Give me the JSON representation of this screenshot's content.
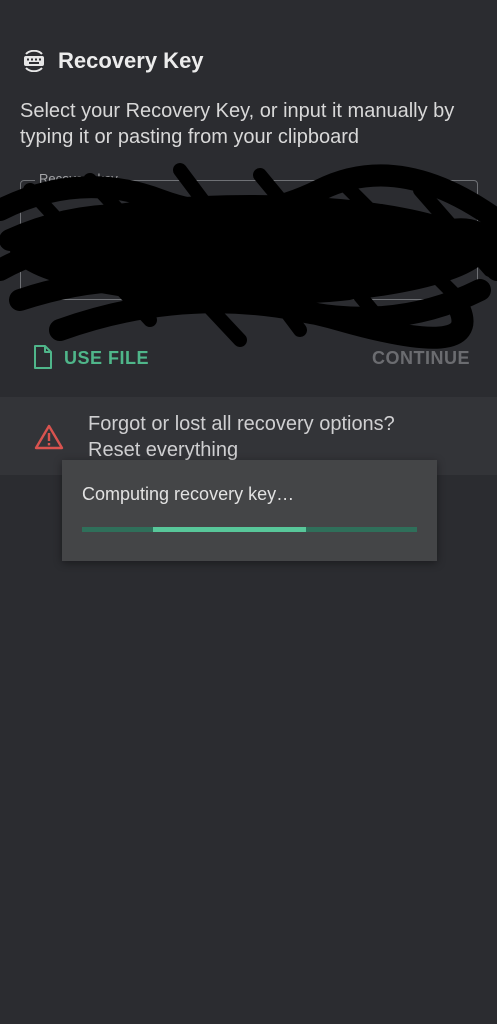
{
  "header": {
    "title": "Recovery Key",
    "icon": "keyboard-key-icon"
  },
  "instructions": "Select your Recovery Key, or input it manually by typing it or pasting from your clipboard",
  "key_field": {
    "label": "Recovery key",
    "value_redacted": true
  },
  "actions": {
    "use_file_label": "USE FILE",
    "use_file_icon": "file-icon",
    "continue_label": "CONTINUE"
  },
  "warning": {
    "line1": "Forgot or lost all recovery options?",
    "line2": "Reset everything",
    "icon": "warning-triangle-icon",
    "icon_color": "#d9534f"
  },
  "dialog": {
    "message": "Computing recovery key…",
    "progress_state": "indeterminate"
  },
  "colors": {
    "background": "#2b2c30",
    "accent": "#4fb68a",
    "disabled": "#6b6c70",
    "dialog_bg": "#444547"
  }
}
